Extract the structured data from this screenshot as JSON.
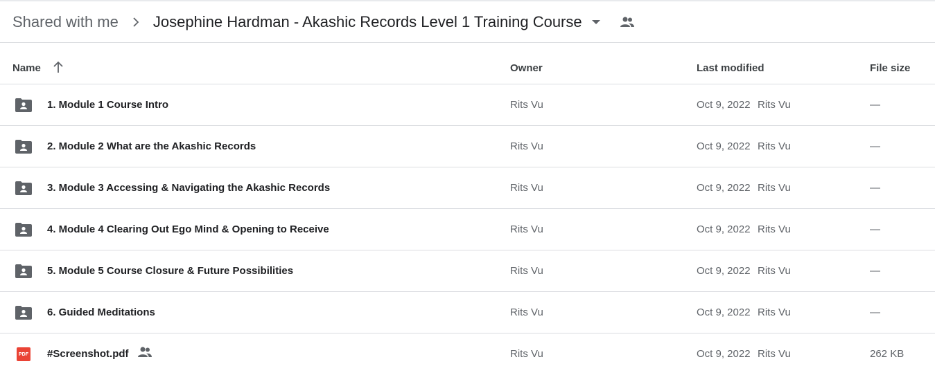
{
  "breadcrumb": {
    "root": "Shared with me",
    "current": "Josephine Hardman - Akashic Records Level 1 Training Course"
  },
  "columns": {
    "name": "Name",
    "owner": "Owner",
    "last_modified": "Last modified",
    "file_size": "File size"
  },
  "rows": [
    {
      "type": "folder",
      "name": "1. Module 1 Course Intro",
      "owner": "Rits Vu",
      "date": "Oct 9, 2022",
      "modified_by": "Rits Vu",
      "size": "—"
    },
    {
      "type": "folder",
      "name": "2. Module 2 What are the Akashic Records",
      "owner": "Rits Vu",
      "date": "Oct 9, 2022",
      "modified_by": "Rits Vu",
      "size": "—"
    },
    {
      "type": "folder",
      "name": "3. Module 3 Accessing & Navigating the Akashic Records",
      "owner": "Rits Vu",
      "date": "Oct 9, 2022",
      "modified_by": "Rits Vu",
      "size": "—"
    },
    {
      "type": "folder",
      "name": "4. Module 4 Clearing Out Ego Mind & Opening to Receive",
      "owner": "Rits Vu",
      "date": "Oct 9, 2022",
      "modified_by": "Rits Vu",
      "size": "—"
    },
    {
      "type": "folder",
      "name": "5. Module 5 Course Closure & Future Possibilities",
      "owner": "Rits Vu",
      "date": "Oct 9, 2022",
      "modified_by": "Rits Vu",
      "size": "—"
    },
    {
      "type": "folder",
      "name": "6. Guided Meditations",
      "owner": "Rits Vu",
      "date": "Oct 9, 2022",
      "modified_by": "Rits Vu",
      "size": "—"
    },
    {
      "type": "pdf",
      "name": "#Screenshot.pdf",
      "owner": "Rits Vu",
      "date": "Oct 9, 2022",
      "modified_by": "Rits Vu",
      "size": "262 KB"
    }
  ],
  "pdf_badge": "PDF",
  "colors": {
    "pdf": "#ea4335",
    "folder": "#5f6368"
  },
  "icons": [
    "chevron-right-icon",
    "dropdown-caret-icon",
    "people-icon",
    "arrow-up-icon",
    "shared-folder-icon",
    "pdf-icon"
  ]
}
